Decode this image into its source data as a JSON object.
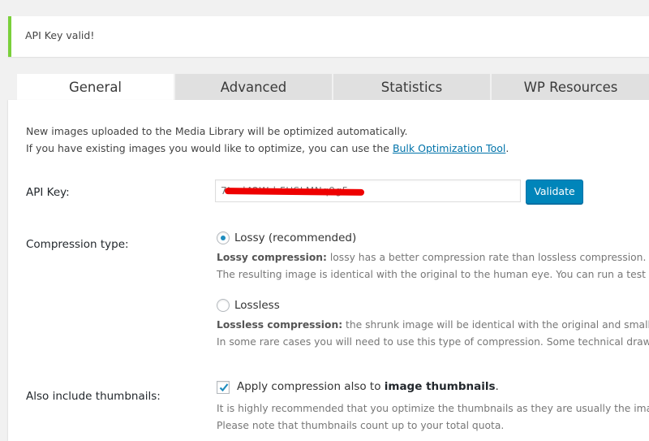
{
  "notice": {
    "text": "API Key valid!",
    "accent_color": "#7ad03a"
  },
  "tabs": [
    {
      "label": "General",
      "active": true
    },
    {
      "label": "Advanced",
      "active": false
    },
    {
      "label": "Statistics",
      "active": false
    },
    {
      "label": "WP Resources",
      "active": false
    }
  ],
  "intro": {
    "line1": "New images uploaded to the Media Library will be optimized automatically.",
    "line2_prefix": "If you have existing images you would like to optimize, you can use the ",
    "link_text": "Bulk Optimization Tool",
    "line2_suffix": "."
  },
  "api_key": {
    "label": "API Key:",
    "value": "7Lvd42Wrl:FUSLMNq9g5",
    "redacted": true,
    "validate_label": "Validate",
    "button_color": "#0085ba"
  },
  "compression": {
    "label": "Compression type:",
    "options": [
      {
        "label": "Lossy (recommended)",
        "checked": true,
        "desc_bold": "Lossy compression:",
        "desc_line1": " lossy has a better compression rate than lossless compression.",
        "desc_line2": "The resulting image is identical with the original to the human eye. You can run a test fo"
      },
      {
        "label": "Lossless",
        "checked": false,
        "desc_bold": "Lossless compression:",
        "desc_line1": " the shrunk image will be identical with the original and smaller i",
        "desc_line2": "In some rare cases you will need to use this type of compression. Some technical drawi"
      }
    ]
  },
  "thumbnails": {
    "label": "Also include thumbnails:",
    "checked": true,
    "check_prefix": "Apply compression also to ",
    "check_bold": "image thumbnails",
    "check_suffix": ".",
    "desc_line1": "It is highly recommended that you optimize the thumbnails as they are usually the imag",
    "desc_line2": "Please note that thumbnails count up to your total quota."
  }
}
